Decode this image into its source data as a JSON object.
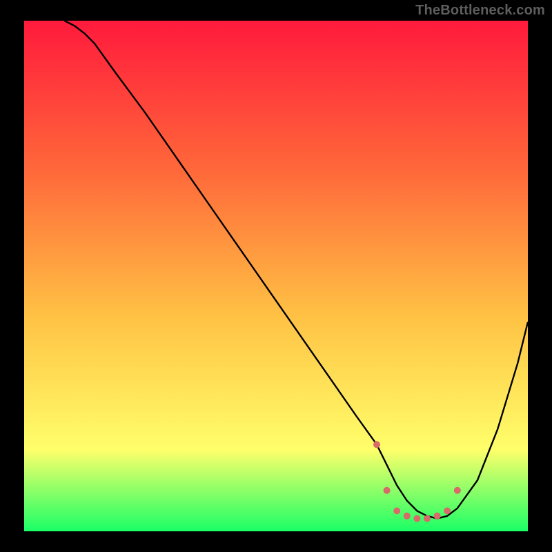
{
  "watermark": "TheBottleneck.com",
  "chart_data": {
    "type": "line",
    "title": "",
    "xlabel": "",
    "ylabel": "",
    "xlim": [
      0,
      100
    ],
    "ylim": [
      0,
      100
    ],
    "grid": false,
    "legend": false,
    "background_gradient": [
      "#ff1a3c",
      "#ff6a3a",
      "#ffc244",
      "#ffff6a",
      "#1aff66"
    ],
    "series": [
      {
        "name": "curve",
        "stroke": "#000000",
        "x": [
          8,
          10,
          12,
          14,
          18,
          24,
          30,
          36,
          42,
          48,
          54,
          60,
          66,
          70,
          72,
          74,
          76,
          78,
          80,
          82,
          84,
          86,
          90,
          94,
          98,
          100
        ],
        "y": [
          100,
          99,
          97.5,
          95.5,
          90,
          82,
          73.5,
          65,
          56.5,
          48,
          39.5,
          31,
          22.5,
          17,
          13,
          9,
          6,
          4,
          3,
          2.5,
          3,
          4.5,
          10,
          20,
          33,
          41
        ]
      }
    ],
    "markers": {
      "name": "trough-dots",
      "color": "#d86a6a",
      "radius": 5,
      "x": [
        70,
        72,
        74,
        76,
        78,
        80,
        82,
        84,
        86
      ],
      "y": [
        17,
        8,
        4,
        3,
        2.5,
        2.5,
        3,
        4,
        8
      ]
    }
  }
}
